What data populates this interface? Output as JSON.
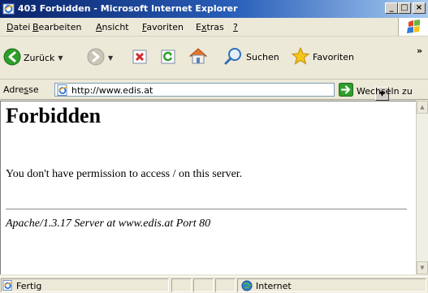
{
  "window": {
    "title": "403 Forbidden - Microsoft Internet Explorer",
    "caption_min": "_",
    "caption_max": "□",
    "caption_close": "×"
  },
  "menu": {
    "items": [
      {
        "pre": "",
        "acc": "D",
        "post": "atei"
      },
      {
        "pre": "",
        "acc": "B",
        "post": "earbeiten"
      },
      {
        "pre": "",
        "acc": "A",
        "post": "nsicht"
      },
      {
        "pre": "",
        "acc": "F",
        "post": "avoriten"
      },
      {
        "pre": "E",
        "acc": "x",
        "post": "tras"
      },
      {
        "pre": "",
        "acc": "?",
        "post": ""
      }
    ]
  },
  "toolbar": {
    "back_label": "Zurück",
    "search_label": "Suchen",
    "favorites_label": "Favoriten",
    "overflow": "»"
  },
  "address": {
    "label_pre": "Adre",
    "label_acc": "s",
    "label_post": "se",
    "url": "http://www.edis.at",
    "go_label": "Wechseln zu"
  },
  "page": {
    "heading": "Forbidden",
    "message": "You don't have permission to access / on this server.",
    "server_signature": "Apache/1.3.17 Server at www.edis.at Port 80"
  },
  "status": {
    "text": "Fertig",
    "zone": "Internet"
  },
  "colors": {
    "title_bar": "#0A246A",
    "chrome": "#ECE9D8",
    "back_green": "#2E9E2A",
    "stop_red": "#D32A2A",
    "star_yellow": "#F5C518"
  },
  "icons": {
    "app": "ie-logo-icon",
    "back": "back-arrow-icon",
    "forward": "forward-arrow-icon",
    "stop": "stop-icon",
    "refresh": "refresh-icon",
    "home": "home-icon",
    "search": "search-magnifier-icon",
    "favorites": "favorites-star-icon",
    "go": "go-arrow-icon",
    "throbber": "windows-flag-icon",
    "page": "page-ie-icon",
    "zone": "internet-globe-icon"
  }
}
